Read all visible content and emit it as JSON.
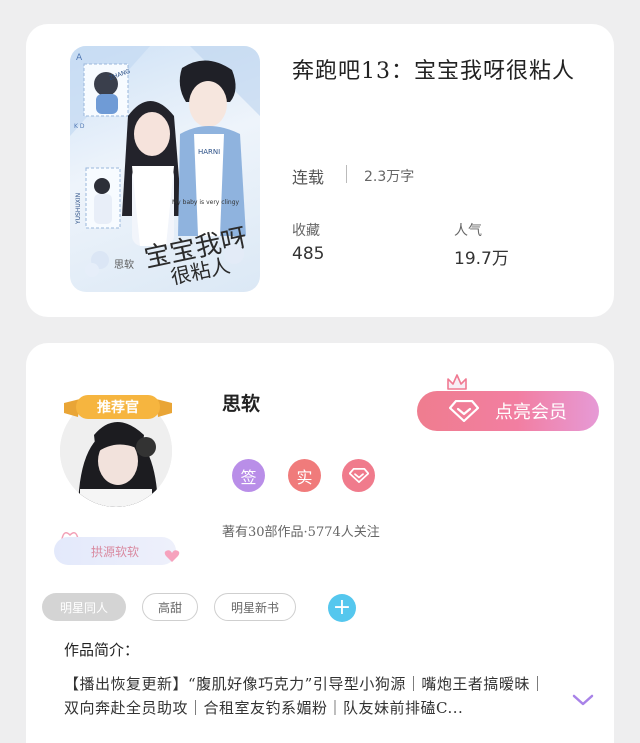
{
  "book": {
    "title": "奔跑吧13：宝宝我呀很粘人",
    "status": "连载",
    "word_count": "2.3万字",
    "favorites_label": "收藏",
    "favorites_value": "485",
    "popularity_label": "人气",
    "popularity_value": "19.7万",
    "cover_calligraphy": "宝宝我呀很粘人",
    "cover_subtitle": "My baby is very clingy",
    "cover_names": [
      "ZHANG",
      "YUSHUXIN",
      "HARNI"
    ],
    "cover_author": "思软"
  },
  "author": {
    "name": "思软",
    "avatar_ribbon": "推荐官",
    "vip_button_label": "点亮会员",
    "badges": [
      {
        "label": "签",
        "color": "#b98ee8"
      },
      {
        "label": "实",
        "color": "#f07b7b"
      },
      {
        "icon": "diamond-icon",
        "color": "#f07b8c"
      }
    ],
    "stats": "著有30部作品·5774人关注",
    "fan_badge": "拱源软软",
    "tags": [
      "明星同人",
      "高甜",
      "明星新书"
    ],
    "intro_title": "作品简介：",
    "intro_text": "【播出恢复更新】“腹肌好像巧克力”引导型小狗源｜嘴炮王者搞暧昧｜双向奔赴全员助攻｜合租室友钓系媚粉｜队友妹前排磕C..."
  },
  "colors": {
    "accent_pink": "#f07e9a",
    "tag_active": "#d4d4d4",
    "add_blue": "#55c7ee",
    "chevron": "#a882e8"
  }
}
